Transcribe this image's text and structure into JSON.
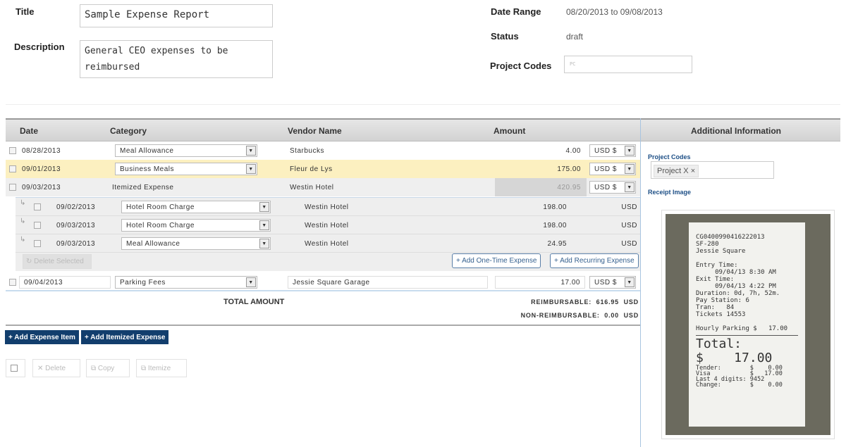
{
  "form": {
    "title_label": "Title",
    "title_value": "Sample Expense Report",
    "description_label": "Description",
    "description_value": "General CEO expenses to be reimbursed",
    "date_range_label": "Date Range",
    "date_range_value": "08/20/2013 to 09/08/2013",
    "status_label": "Status",
    "status_value": "draft",
    "project_codes_label": "Project Codes",
    "project_codes_placeholder": "PC"
  },
  "table": {
    "headers": {
      "date": "Date",
      "category": "Category",
      "vendor": "Vendor Name",
      "amount": "Amount",
      "additional": "Additional Information"
    },
    "rows": [
      {
        "date": "08/28/2013",
        "category": "Meal Allowance",
        "vendor": "Starbucks",
        "amount": "4.00",
        "currency": "USD $"
      },
      {
        "date": "09/01/2013",
        "category": "Business Meals",
        "vendor": "Fleur de Lys",
        "amount": "175.00",
        "currency": "USD $"
      },
      {
        "date": "09/03/2013",
        "category": "Itemized Expense",
        "vendor": "Westin Hotel",
        "amount": "420.95",
        "currency": "USD $"
      },
      {
        "date": "09/04/2013",
        "category": "Parking Fees",
        "vendor": "Jessie Square Garage",
        "amount": "17.00",
        "currency": "USD $"
      }
    ],
    "subrows": [
      {
        "date": "09/02/2013",
        "category": "Hotel Room Charge",
        "vendor": "Westin Hotel",
        "amount": "198.00",
        "currency": "USD"
      },
      {
        "date": "09/03/2013",
        "category": "Hotel Room Charge",
        "vendor": "Westin Hotel",
        "amount": "198.00",
        "currency": "USD"
      },
      {
        "date": "09/03/2013",
        "category": "Meal Allowance",
        "vendor": "Westin Hotel",
        "amount": "24.95",
        "currency": "USD"
      }
    ],
    "delete_selected": "Delete Selected",
    "add_one_time": "+ Add One-Time Expense",
    "add_recurring": "+ Add Recurring Expense",
    "total_label": "TOTAL AMOUNT",
    "reimbursable": "REIMBURSABLE:  616.95  USD",
    "non_reimbursable": "NON-REIMBURSABLE:  0.00  USD"
  },
  "actions": {
    "add_expense_item": "+ Add Expense Item",
    "add_itemized": "+ Add Itemized Expense",
    "delete": "Delete",
    "copy": "Copy",
    "itemize": "Itemize"
  },
  "side": {
    "project_codes_label": "Project Codes",
    "project_tag": "Project X",
    "receipt_label": "Receipt Image",
    "receipt_text": "CG0400990416222013\nSF-280\nJessie Square\n\nEntry Time:\n     09/04/13 8:30 AM\nExit Time:\n     09/04/13 4:22 PM\nDuration: 0d, 7h, 52m.\nPay Station: 6\nTran:   84\nTickets 14553\n\nHourly Parking $   17.00",
    "receipt_total_label": "Total:",
    "receipt_total": "$    17.00",
    "receipt_footer": "Tender:        $    0.00\nVisa           $   17.00\nLast 4 digits: 9452\nChange:        $    0.00"
  }
}
